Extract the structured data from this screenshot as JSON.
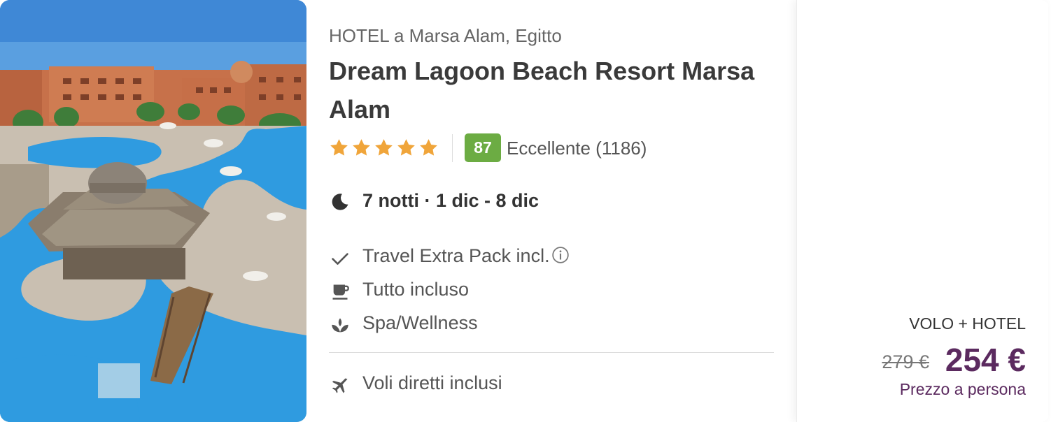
{
  "hotel": {
    "location": "HOTEL a Marsa Alam, Egitto",
    "name": "Dream Lagoon Beach Resort Marsa Alam",
    "stars": 5,
    "score": "87",
    "score_label": "Eccellente (1186)"
  },
  "stay": {
    "text": "7 notti · 1 dic - 8 dic"
  },
  "features": [
    {
      "icon": "check-icon",
      "label": "Travel Extra Pack incl."
    },
    {
      "icon": "coffee-cup-icon",
      "label": "Tutto incluso"
    },
    {
      "icon": "lotus-icon",
      "label": "Spa/Wellness"
    }
  ],
  "flights": {
    "icon": "airplane-icon",
    "label": "Voli diretti inclusi"
  },
  "price": {
    "product_type": "VOLO + HOTEL",
    "old_price": "279 €",
    "new_price": "254 €",
    "note": "Prezzo a persona"
  },
  "colors": {
    "star": "#f0a53a",
    "score_badge": "#6cac43",
    "price": "#5b2a5f",
    "text_primary": "#333333",
    "text_secondary": "#666666"
  }
}
